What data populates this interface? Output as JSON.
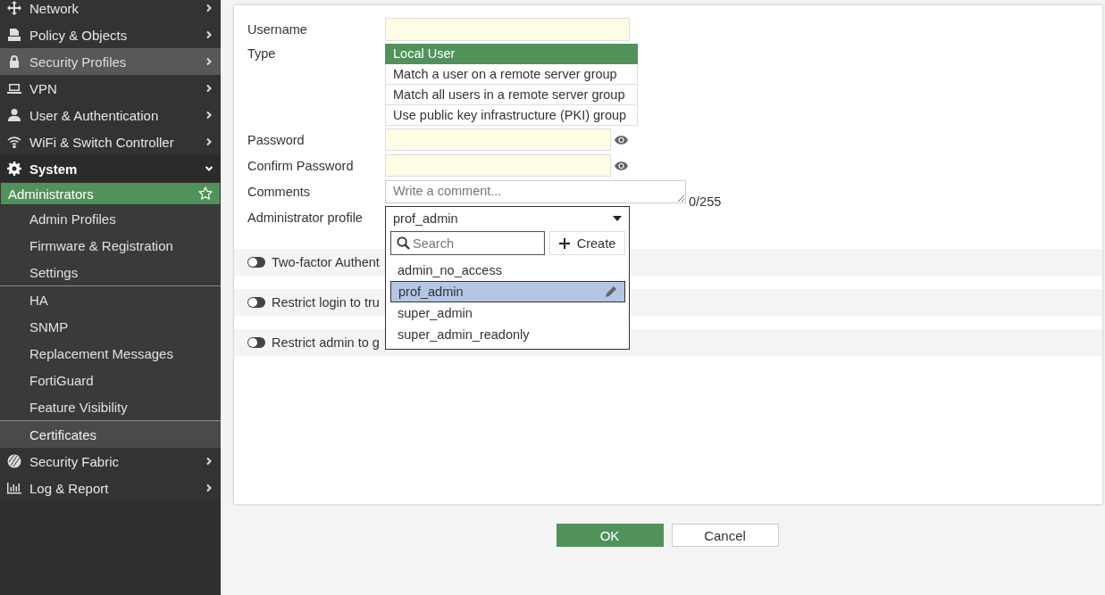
{
  "sidebar": {
    "items": [
      {
        "label": "Network",
        "expanded": false,
        "highlighted": false
      },
      {
        "label": "Policy & Objects",
        "expanded": false,
        "highlighted": false
      },
      {
        "label": "Security Profiles",
        "expanded": false,
        "highlighted": true
      },
      {
        "label": "VPN",
        "expanded": false,
        "highlighted": false
      },
      {
        "label": "User & Authentication",
        "expanded": false,
        "highlighted": false
      },
      {
        "label": "WiFi & Switch Controller",
        "expanded": false,
        "highlighted": false
      },
      {
        "label": "System",
        "expanded": true,
        "highlighted": false,
        "children": [
          {
            "label": "Administrators",
            "selected": true,
            "highlighted": false,
            "divider_before": false
          },
          {
            "label": "Admin Profiles",
            "selected": false,
            "highlighted": false,
            "divider_before": false
          },
          {
            "label": "Firmware & Registration",
            "selected": false,
            "highlighted": false,
            "divider_before": false
          },
          {
            "label": "Settings",
            "selected": false,
            "highlighted": false,
            "divider_before": false
          },
          {
            "label": "HA",
            "selected": false,
            "highlighted": false,
            "divider_before": true
          },
          {
            "label": "SNMP",
            "selected": false,
            "highlighted": false,
            "divider_before": false
          },
          {
            "label": "Replacement Messages",
            "selected": false,
            "highlighted": false,
            "divider_before": false
          },
          {
            "label": "FortiGuard",
            "selected": false,
            "highlighted": false,
            "divider_before": false
          },
          {
            "label": "Feature Visibility",
            "selected": false,
            "highlighted": false,
            "divider_before": false
          },
          {
            "label": "Certificates",
            "selected": false,
            "highlighted": true,
            "divider_before": true
          }
        ]
      },
      {
        "label": "Security Fabric",
        "expanded": false,
        "highlighted": false
      },
      {
        "label": "Log & Report",
        "expanded": false,
        "highlighted": false
      }
    ]
  },
  "form": {
    "fields": [
      {
        "kind": "text",
        "label": "Username"
      },
      {
        "kind": "choice",
        "label": "Type",
        "options": [
          {
            "label": "Local User",
            "selected": true
          },
          {
            "label": "Match a user on a remote server group",
            "selected": false
          },
          {
            "label": "Match all users in a remote server group",
            "selected": false
          },
          {
            "label": "Use public key infrastructure (PKI) group",
            "selected": false
          }
        ]
      },
      {
        "kind": "password",
        "label": "Password"
      },
      {
        "kind": "password",
        "label": "Confirm Password"
      },
      {
        "kind": "textarea",
        "label": "Comments",
        "placeholder": "Write a comment...",
        "counter": "0/255"
      },
      {
        "kind": "select",
        "label": "Administrator profile",
        "value": "prof_admin",
        "open": true
      }
    ]
  },
  "toggles": [
    {
      "label": "Two-factor Authent",
      "on": false
    },
    {
      "label": "Restrict login to tru",
      "on": false
    },
    {
      "label": "Restrict admin to g",
      "on": false
    }
  ],
  "profile_dropdown": {
    "search_placeholder": "Search",
    "create_label": "Create",
    "options": [
      {
        "label": "admin_no_access",
        "selected": false
      },
      {
        "label": "prof_admin",
        "selected": true
      },
      {
        "label": "super_admin",
        "selected": false
      },
      {
        "label": "super_admin_readonly",
        "selected": false
      }
    ]
  },
  "buttons": [
    {
      "label": "OK",
      "kind": "primary"
    },
    {
      "label": "Cancel",
      "kind": "secondary"
    }
  ]
}
